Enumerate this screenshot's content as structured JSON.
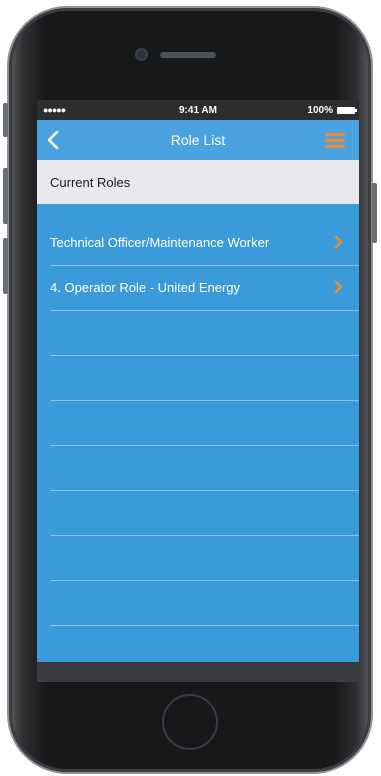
{
  "statusbar": {
    "signal": "●●●●● ",
    "time": "9:41 AM",
    "battery": "100%"
  },
  "navbar": {
    "title": "Role List",
    "back_icon": "chevron-left-icon",
    "menu_icon": "hamburger-menu-icon"
  },
  "section": {
    "title": "Current Roles"
  },
  "roles": [
    "Technical Officer/Maintenance Worker",
    "4. Operator Role - United Energy",
    "",
    "",
    "",
    "",
    "",
    "",
    ""
  ],
  "colors": {
    "accent": "#f28a2a",
    "list_bg": "#3b9ad9",
    "nav_bg": "#4aa3e0"
  }
}
